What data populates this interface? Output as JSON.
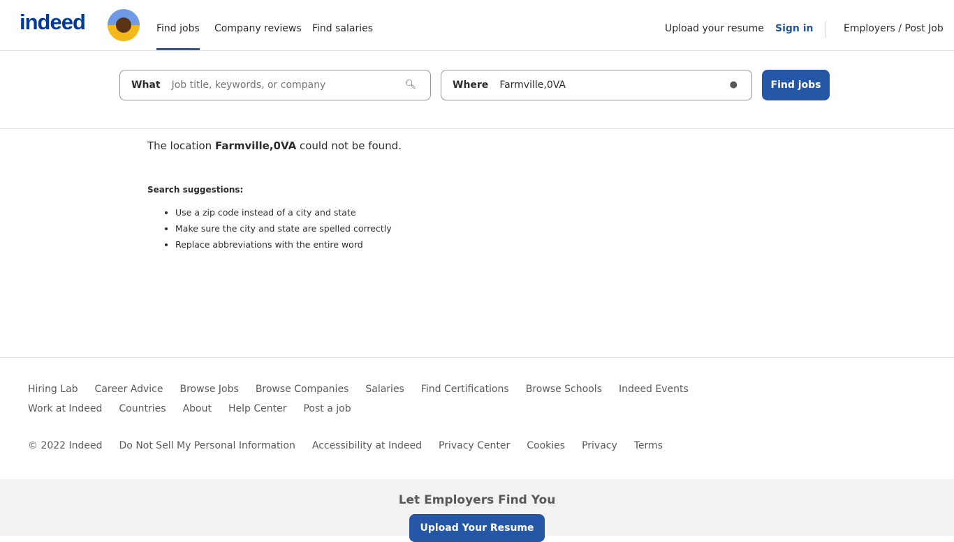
{
  "header": {
    "logo": "indeed",
    "nav": [
      "Find jobs",
      "Company reviews",
      "Find salaries"
    ],
    "upload": "Upload your resume",
    "signin": "Sign in",
    "employers": "Employers / Post Job"
  },
  "search": {
    "what_label": "What",
    "what_placeholder": "Job title, keywords, or company",
    "where_label": "Where",
    "where_value": "Farmville,0VA",
    "button": "Find jobs"
  },
  "main": {
    "msg_pre": "The location ",
    "msg_loc": "Farmville,0VA",
    "msg_post": " could not be found.",
    "suggestions_title": "Search suggestions:",
    "suggestions": [
      "Use a zip code instead of a city and state",
      "Make sure the city and state are spelled correctly",
      "Replace abbreviations with the entire word"
    ]
  },
  "footer": {
    "row1": [
      "Hiring Lab",
      "Career Advice",
      "Browse Jobs",
      "Browse Companies",
      "Salaries",
      "Find Certifications",
      "Browse Schools",
      "Indeed Events"
    ],
    "row2": [
      "Work at Indeed",
      "Countries",
      "About",
      "Help Center",
      "Post a job"
    ],
    "row3": [
      "© 2022 Indeed",
      "Do Not Sell My Personal Information",
      "Accessibility at Indeed",
      "Privacy Center",
      "Cookies",
      "Privacy",
      "Terms"
    ]
  },
  "banner": {
    "title": "Let Employers Find You",
    "button": "Upload Your Resume"
  }
}
